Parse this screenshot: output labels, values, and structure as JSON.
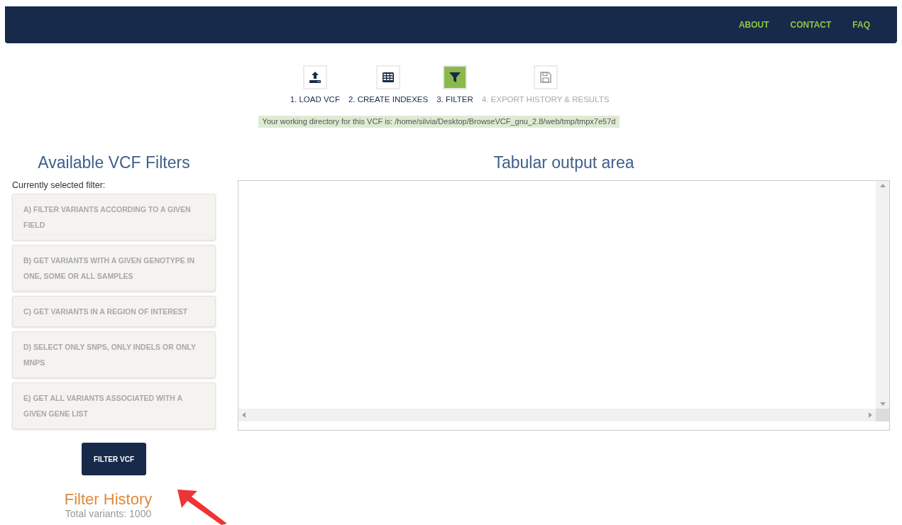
{
  "nav": {
    "links": [
      "ABOUT",
      "CONTACT",
      "FAQ"
    ]
  },
  "steps": [
    {
      "label": "1. LOAD VCF",
      "selected": false,
      "disabled": false
    },
    {
      "label": "2. CREATE INDEXES",
      "selected": false,
      "disabled": false
    },
    {
      "label": "3. FILTER",
      "selected": true,
      "disabled": false
    },
    {
      "label": "4. EXPORT HISTORY & RESULTS",
      "selected": false,
      "disabled": true
    }
  ],
  "working_directory": "Your working directory for this VCF is: /home/silvia/Desktop/BrowseVCF_gnu_2.8/web/tmp/tmpx7e57d",
  "filters_panel": {
    "title": "Available VCF Filters",
    "subtitle": "Currently selected filter:",
    "filters": [
      {
        "label": "A) FILTER VARIANTS ACCORDING TO A GIVEN FIELD",
        "selected": false
      },
      {
        "label": "B) GET VARIANTS WITH A GIVEN GENOTYPE IN ONE, SOME OR ALL SAMPLES",
        "selected": false
      },
      {
        "label": "C) GET VARIANTS IN A REGION OF INTEREST",
        "selected": false
      },
      {
        "label": "D) SELECT ONLY SNPS, ONLY INDELS OR ONLY MNPS",
        "selected": false
      },
      {
        "label": "E) GET ALL VARIANTS ASSOCIATED WITH A GIVEN GENE LIST",
        "selected": false
      }
    ],
    "button": "FILTER VCF"
  },
  "history": {
    "title": "Filter History",
    "total": "Total variants: 1000"
  },
  "output": {
    "title": "Tabular output area"
  }
}
